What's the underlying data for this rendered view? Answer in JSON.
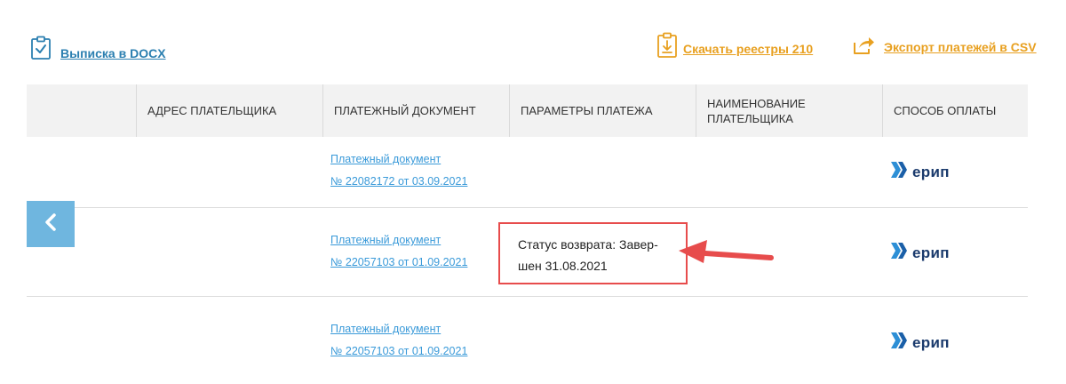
{
  "toolbar": {
    "docx_label": "Выписка в DOCX",
    "reestr_label": "Скачать реестры 210",
    "csv_label": "Экспорт платежей в CSV"
  },
  "table": {
    "columns": [
      "",
      "АДРЕС ПЛАТЕЛЬЩИКА",
      "ПЛАТЕЖНЫЙ ДОКУМЕНТ",
      "ПАРАМЕТРЫ ПЛАТЕЖА",
      "НАИМЕНОВАНИЕ ПЛАТЕЛЬЩИКА",
      "СПОСОБ ОПЛАТЫ"
    ],
    "rows": [
      {
        "doc_line1": "Платежный документ",
        "doc_line2": "№ 22082172 от 03.09.2021",
        "payment": "ерип"
      },
      {
        "doc_line1": "Платежный документ",
        "doc_line2": "№ 22057103 от 01.09.2021",
        "payment": "ерип"
      },
      {
        "doc_line1": "Платежный документ",
        "doc_line2": "№ 22057103 от 01.09.2021",
        "payment": "ерип"
      }
    ]
  },
  "annotation": {
    "status_line1": "Статус возврата: Завер-",
    "status_line2": "шен 31.08.2021",
    "box_color": "#e74c4c",
    "arrow_color": "#e74c4c"
  },
  "colors": {
    "link_blue": "#2b7fb0",
    "accent_orange": "#e8a020",
    "doc_link": "#3a9ad9",
    "back_button": "#6fb6df",
    "header_bg": "#f2f2f2"
  },
  "icons": [
    "clipboard-check-icon",
    "clipboard-download-icon",
    "export-arrow-icon",
    "chevron-left-icon",
    "erip-logo-icon"
  ]
}
